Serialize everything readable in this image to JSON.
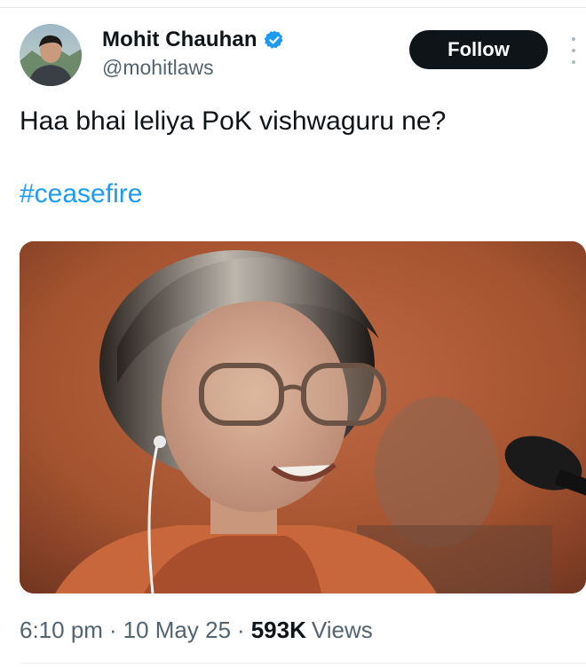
{
  "author": {
    "name": "Mohit Chauhan",
    "handle": "@mohitlaws",
    "verified": true,
    "verified_color": "#1d9bf0"
  },
  "follow_button": {
    "label": "Follow"
  },
  "tweet": {
    "text": "Haa bhai leliya PoK vishwaguru ne?",
    "hashtag": "#ceasefire",
    "hashtag_color": "#1d9bf0"
  },
  "meta": {
    "time": "6:10 pm",
    "separator": "·",
    "date": "10 May 25",
    "views_count": "593K",
    "views_label": "Views"
  },
  "icons": {
    "verified": "verified-badge-icon",
    "more": "more-vertical-icon"
  }
}
